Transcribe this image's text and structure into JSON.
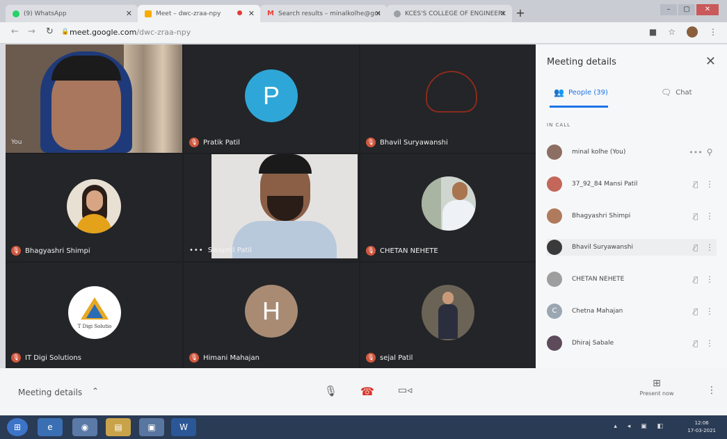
{
  "browser": {
    "tabs": [
      {
        "title": "(9) WhatsApp",
        "favicon": "#25d366"
      },
      {
        "title": "Meet – dwc-zraa-npy",
        "favicon": "#f9ab00"
      },
      {
        "title": "Search results – minalkolhe@gm",
        "favicon": "#ea4335"
      },
      {
        "title": "KCES'S COLLEGE OF ENGINEERI",
        "favicon": "#9aa0a6"
      }
    ],
    "url_host": "meet.google.com",
    "url_path": "/dwc-zraa-npy"
  },
  "tiles": {
    "you_label": "You",
    "pratik": {
      "name": "Pratik Patil",
      "initial": "P",
      "color": "#2ea7d8"
    },
    "bhavil": {
      "name": "Bhavil Suryawanshi"
    },
    "bhagyashri": {
      "name": "Bhagyashri Shimpi"
    },
    "swapnil": {
      "name": "Swapnil Patil"
    },
    "chetan": {
      "name": "CHETAN NEHETE"
    },
    "itdigi": {
      "name": "IT Digi Solutions",
      "logo_text": "T Digi Solutio"
    },
    "himani": {
      "name": "Himani Mahajan",
      "initial": "H",
      "color": "#a98b74"
    },
    "sejal": {
      "name": "sejal Patil"
    }
  },
  "panel": {
    "title": "Meeting details",
    "people_tab": "People (39)",
    "chat_tab": "Chat",
    "section": "IN CALL",
    "participants": [
      {
        "name": "minal kolhe (You)",
        "color": "#8d6e63"
      },
      {
        "name": "37_92_84 Mansi Patil",
        "color": "#c2675a"
      },
      {
        "name": "Bhagyashri Shimpi",
        "color": "#b07a5c"
      },
      {
        "name": "Bhavil Suryawanshi",
        "color": "#3a3a3a"
      },
      {
        "name": "CHETAN NEHETE",
        "color": "#9e9e9e"
      },
      {
        "name": "Chetna Mahajan",
        "initial": "C",
        "color": "#9aa6b2"
      },
      {
        "name": "Dhiraj Sabale",
        "color": "#5d4a5a"
      }
    ]
  },
  "bottom": {
    "meeting_details": "Meeting details",
    "present_now": "Present now"
  },
  "taskbar": {
    "time": "12:06",
    "date": "17-03-2021"
  }
}
